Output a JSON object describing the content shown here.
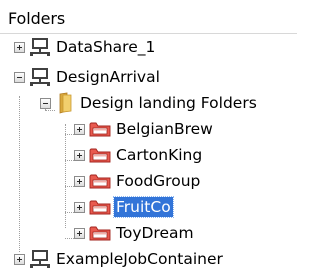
{
  "panel": {
    "title": "Folders"
  },
  "tree": {
    "datashare": "DataShare_1",
    "designarrival": "DesignArrival",
    "landing": "Design landing Folders",
    "children": [
      "BelgianBrew",
      "CartonKing",
      "FoodGroup",
      "FruitCo",
      "ToyDream"
    ],
    "selected": "FruitCo",
    "example": "ExampleJobContainer"
  },
  "icons": {
    "server": "server-icon",
    "folder": "folder-icon",
    "hotfolder": "hotfolder-icon",
    "expand": "expand-plus-icon",
    "collapse": "collapse-minus-icon"
  },
  "colors": {
    "selection": "#3274d8",
    "hotfolder": "#e85a4f",
    "folder": "#f2cf6d"
  }
}
